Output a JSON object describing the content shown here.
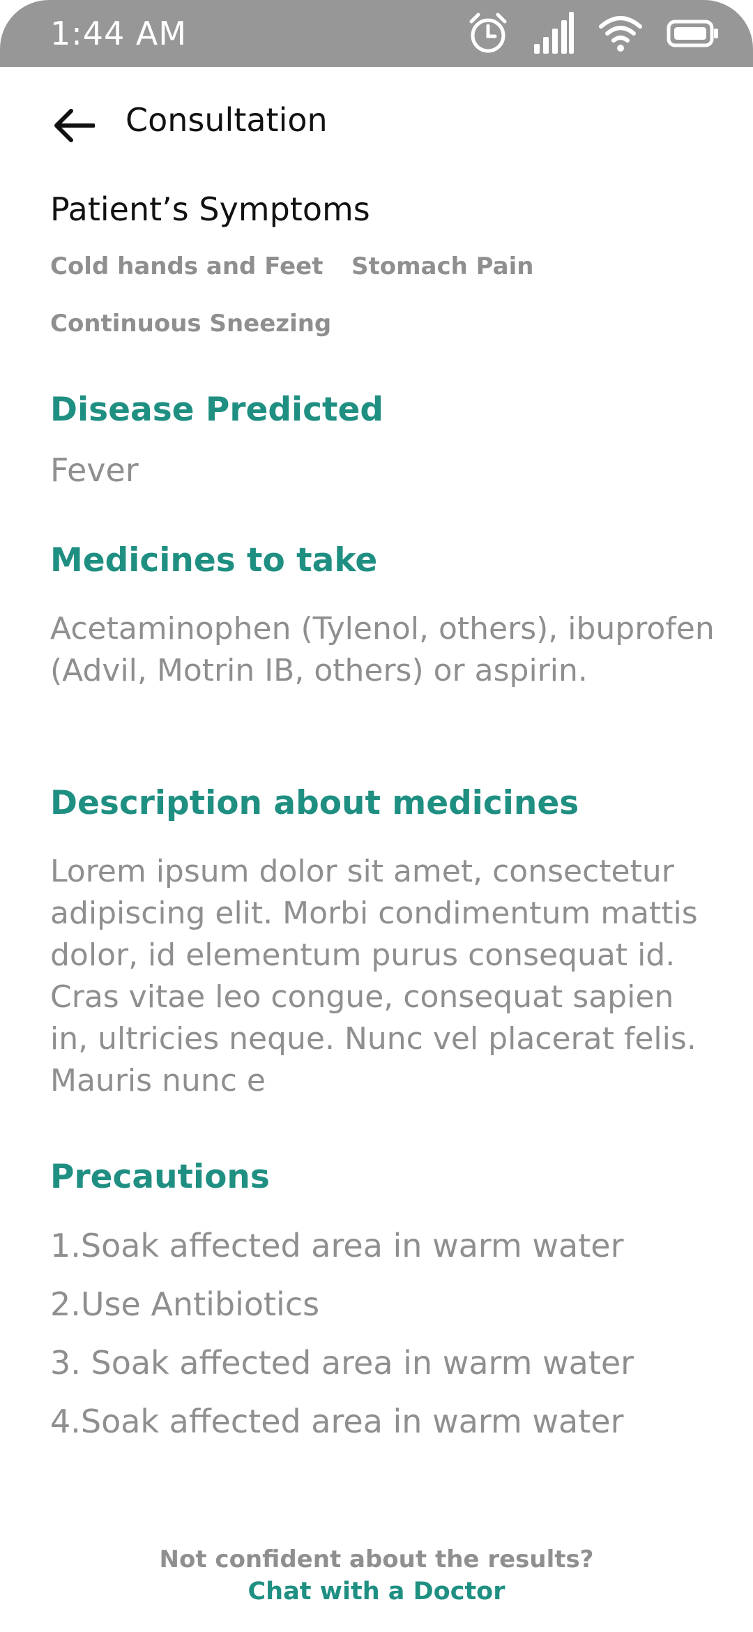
{
  "status_bar": {
    "time": "1:44 AM",
    "icons": [
      "alarm-icon",
      "signal-icon",
      "wifi-icon",
      "battery-icon"
    ]
  },
  "header": {
    "title": "Consultation"
  },
  "symptoms": {
    "title": "Patient’s Symptoms",
    "items": [
      "Cold hands and Feet",
      "Stomach Pain",
      "Continuous Sneezing"
    ]
  },
  "disease": {
    "title": "Disease Predicted",
    "value": "Fever"
  },
  "medicines": {
    "title": "Medicines to take",
    "value": "Acetaminophen (Tylenol, others), ibuprofen (Advil, Motrin IB, others) or aspirin."
  },
  "description": {
    "title": "Description about medicines",
    "value": "Lorem ipsum dolor sit amet, consectetur adipiscing elit. Morbi condimentum mattis dolor, id elementum purus consequat id. Cras vitae leo congue, consequat sapien in, ultricies neque. Nunc vel placerat felis. Mauris nunc e"
  },
  "precautions": {
    "title": "Precautions",
    "items": [
      "1.Soak affected area in warm water",
      "2.Use Antibiotics",
      "3. Soak affected area in warm water",
      "4.Soak affected area in warm water"
    ]
  },
  "footer": {
    "question": "Not confident about the results?",
    "link": "Chat with a Doctor"
  },
  "colors": {
    "accent": "#1f8f82",
    "status_bar": "#979797",
    "muted_text": "#8f8f8f",
    "primary_text": "#111111"
  }
}
